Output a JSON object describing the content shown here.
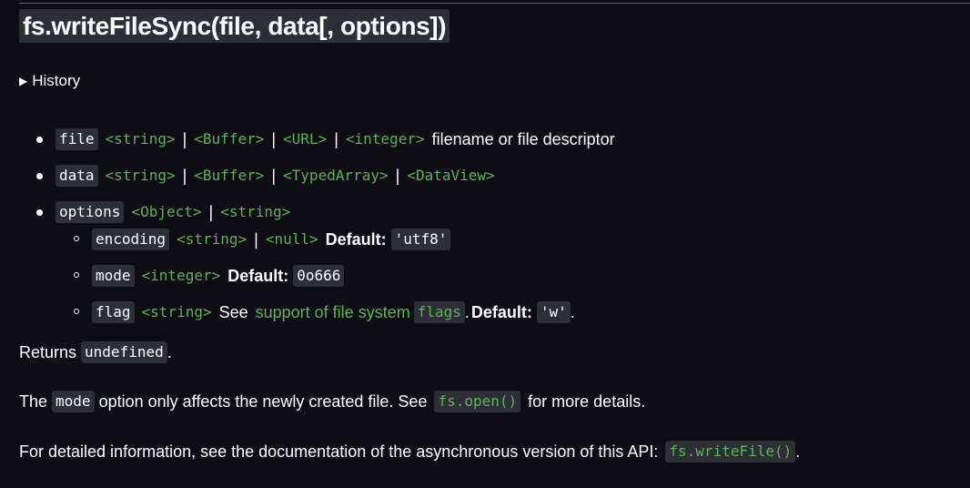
{
  "heading": "fs.writeFileSync(file, data[, options])",
  "history_label": "History",
  "params": {
    "file": {
      "name": "file",
      "types": [
        "<string>",
        "<Buffer>",
        "<URL>",
        "<integer>"
      ],
      "description": "filename or file descriptor"
    },
    "data": {
      "name": "data",
      "types": [
        "<string>",
        "<Buffer>",
        "<TypedArray>",
        "<DataView>"
      ]
    },
    "options": {
      "name": "options",
      "types": [
        "<Object>",
        "<string>"
      ],
      "encoding": {
        "name": "encoding",
        "types": [
          "<string>",
          "<null>"
        ],
        "default_label": "Default:",
        "default_value": "'utf8'"
      },
      "mode": {
        "name": "mode",
        "types": [
          "<integer>"
        ],
        "default_label": "Default:",
        "default_value": "0o666"
      },
      "flag": {
        "name": "flag",
        "types": [
          "<string>"
        ],
        "see_label": "See",
        "link_text": "support of file system",
        "link_code": "flags",
        "after_link": ".",
        "default_label": "Default:",
        "default_value": "'w'",
        "end": "."
      }
    }
  },
  "returns": {
    "prefix": "Returns",
    "value": "undefined",
    "end": "."
  },
  "mode_note": {
    "prefix": "The",
    "code": "mode",
    "middle": "option only affects the newly created file. See",
    "link": "fs.open()",
    "suffix": "for more details."
  },
  "async_note": {
    "prefix": "For detailed information, see the documentation of the asynchronous version of this API:",
    "link": "fs.writeFile()",
    "end": "."
  },
  "colors": {
    "background": "#0d0d13",
    "code_background": "#2c2f36",
    "link_green": "#5fb15a",
    "text": "#ffffff"
  }
}
